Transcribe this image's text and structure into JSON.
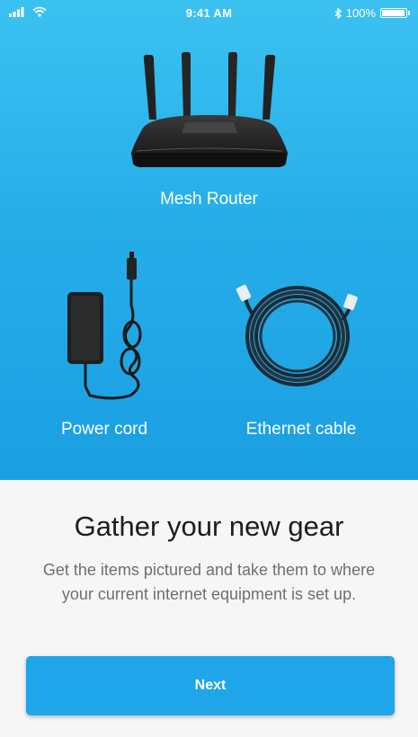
{
  "status_bar": {
    "time": "9:41 AM",
    "battery": "100%",
    "battery_level": 1.0,
    "icons": [
      "signal-icon",
      "wifi-icon",
      "bluetooth-icon",
      "battery-icon"
    ]
  },
  "items": {
    "router": {
      "label": "Mesh Router",
      "icon": "mesh-router-illustration"
    },
    "power": {
      "label": "Power cord",
      "icon": "power-cord-illustration"
    },
    "ethernet": {
      "label": "Ethernet cable",
      "icon": "ethernet-cable-illustration"
    }
  },
  "content": {
    "title": "Gather your new gear",
    "body": "Get the items pictured and take them to where your current internet equipment is set up."
  },
  "actions": {
    "next_label": "Next"
  },
  "colors": {
    "hero_top": "#3cc2f1",
    "hero_bottom": "#1a9fe2",
    "button": "#1ea5ea",
    "panel": "#f6f6f6"
  }
}
